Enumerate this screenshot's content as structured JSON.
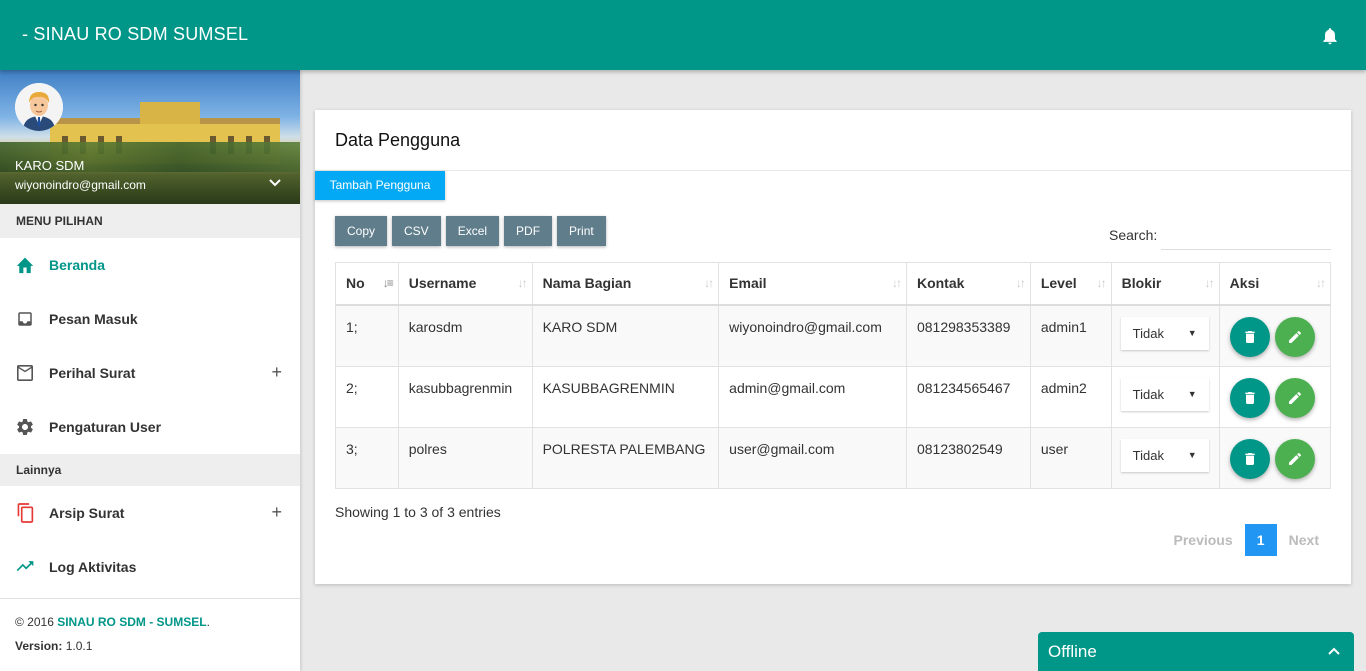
{
  "header": {
    "brand": "- SINAU RO SDM SUMSEL"
  },
  "user": {
    "name": "KARO SDM",
    "email": "wiyonoindro@gmail.com"
  },
  "sidebar": {
    "menu_heading": "MENU PILIHAN",
    "items": [
      {
        "label": "Beranda",
        "icon": "home-icon"
      },
      {
        "label": "Pesan Masuk",
        "icon": "inbox-icon"
      },
      {
        "label": "Perihal Surat",
        "icon": "mail-icon",
        "expand": "+"
      },
      {
        "label": "Pengaturan User",
        "icon": "gear-icon"
      }
    ],
    "other_heading": "Lainnya",
    "other_items": [
      {
        "label": "Arsip Surat",
        "icon": "copy-icon",
        "expand": "+"
      },
      {
        "label": "Log Aktivitas",
        "icon": "trending-icon"
      }
    ],
    "footer": {
      "copyright_prefix": "© 2016 ",
      "copyright_brand": "SINAU RO SDM - SUMSEL",
      "copyright_suffix": ".",
      "version_label": "Version:",
      "version_value": " 1.0.1"
    }
  },
  "card": {
    "title": "Data Pengguna",
    "add_button": "Tambah Pengguna",
    "export_buttons": [
      "Copy",
      "CSV",
      "Excel",
      "PDF",
      "Print"
    ],
    "search_label": "Search:",
    "search_value": "",
    "columns": [
      "No",
      "Username",
      "Nama Bagian",
      "Email",
      "Kontak",
      "Level",
      "Blokir",
      "Aksi"
    ],
    "rows": [
      {
        "no": "1;",
        "username": "karosdm",
        "bagian": "KARO SDM",
        "email": "wiyonoindro@gmail.com",
        "kontak": "081298353389",
        "level": "admin1",
        "blokir": "Tidak"
      },
      {
        "no": "2;",
        "username": "kasubbagrenmin",
        "bagian": "KASUBBAGRENMIN",
        "email": "admin@gmail.com",
        "kontak": "081234565467",
        "level": "admin2",
        "blokir": "Tidak"
      },
      {
        "no": "3;",
        "username": "polres",
        "bagian": "POLRESTA PALEMBANG",
        "email": "user@gmail.com",
        "kontak": "08123802549",
        "level": "user",
        "blokir": "Tidak"
      }
    ],
    "info": "Showing 1 to 3 of 3 entries",
    "pagination": {
      "previous": "Previous",
      "page": "1",
      "next": "Next"
    }
  },
  "chat": {
    "status": "Offline"
  },
  "colors": {
    "primary": "#009688",
    "accent_blue": "#03a9f4",
    "export_btn": "#607d8b",
    "edit_green": "#4caf50",
    "page_active": "#2196f3"
  }
}
